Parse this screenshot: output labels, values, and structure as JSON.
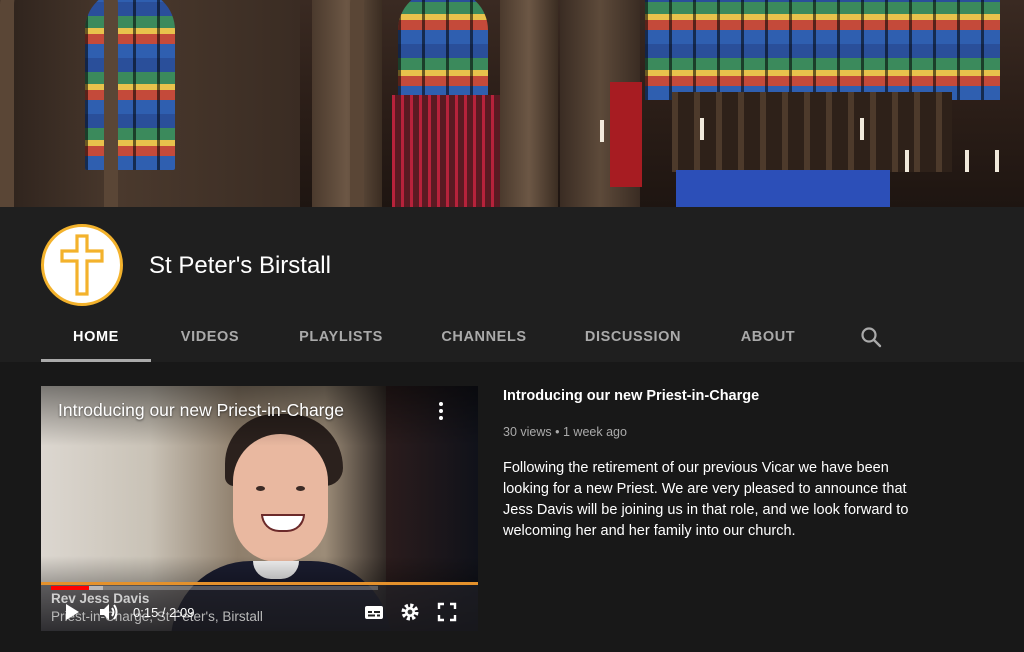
{
  "channel": {
    "name": "St Peter's Birstall",
    "colors": {
      "avatar_ring": "#f3b22c",
      "avatar_cross": "#f3b22c",
      "background": "#181818",
      "header": "#1f1f1f"
    }
  },
  "tabs": [
    {
      "label": "HOME",
      "active": true
    },
    {
      "label": "VIDEOS",
      "active": false
    },
    {
      "label": "PLAYLISTS",
      "active": false
    },
    {
      "label": "CHANNELS",
      "active": false
    },
    {
      "label": "DISCUSSION",
      "active": false
    },
    {
      "label": "ABOUT",
      "active": false
    }
  ],
  "icons": {
    "tab_search": "search-icon",
    "player_menu": "more-vert-icon",
    "play": "play-icon",
    "volume": "volume-icon",
    "subtitles": "subtitles-icon",
    "settings": "gear-icon",
    "fullscreen": "fullscreen-icon",
    "avatar": "cross-icon"
  },
  "featured": {
    "player": {
      "overlay_title": "Introducing our new Priest-in-Charge",
      "lower_third_name": "Rev Jess Davis",
      "lower_third_role": "Priest-in-Charge, St Peter's, Birstall",
      "time_display": "0:15 / 2:09",
      "progress_played": 0.116,
      "progress_loaded": 0.16
    },
    "title": "Introducing our new Priest-in-Charge",
    "views": "30 views",
    "separator": "•",
    "age": "1 week ago",
    "description": "Following the retirement of our previous Vicar we have been looking for a new Priest. We are very pleased to announce that Jess Davis will be joining us in that role, and we look forward to welcoming her and her family into our church."
  }
}
